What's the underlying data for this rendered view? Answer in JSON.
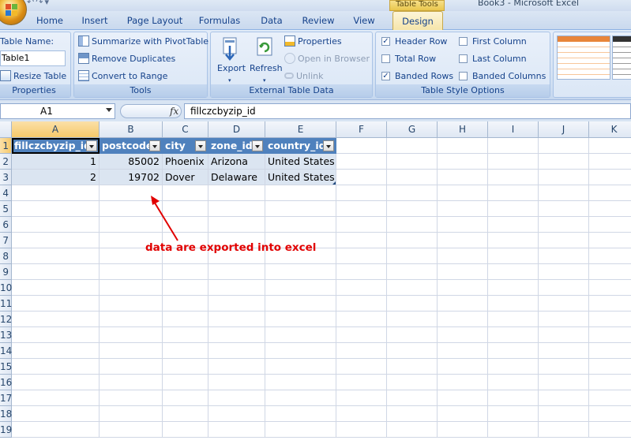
{
  "window": {
    "title": "Book3 - Microsoft Excel",
    "context_tab": "Table Tools"
  },
  "tabs": [
    "Home",
    "Insert",
    "Page Layout",
    "Formulas",
    "Data",
    "Review",
    "View",
    "Design"
  ],
  "active_tab": "Design",
  "ribbon": {
    "properties": {
      "table_name_label": "Table Name:",
      "table_name_value": "Table1",
      "resize": "Resize Table",
      "group": "Properties"
    },
    "tools": {
      "summarize": "Summarize with PivotTable",
      "remove_duplicates": "Remove Duplicates",
      "convert": "Convert to Range",
      "group": "Tools"
    },
    "external": {
      "export": "Export",
      "refresh": "Refresh",
      "properties": "Properties",
      "open_browser": "Open in Browser",
      "unlink": "Unlink",
      "group": "External Table Data"
    },
    "style_options": {
      "header_row": "Header Row",
      "total_row": "Total Row",
      "banded_rows": "Banded Rows",
      "first_column": "First Column",
      "last_column": "Last Column",
      "banded_columns": "Banded Columns",
      "group": "Table Style Options",
      "header_row_checked": true,
      "total_row_checked": false,
      "banded_rows_checked": true,
      "first_column_checked": false,
      "last_column_checked": false,
      "banded_columns_checked": false
    }
  },
  "formula_bar": {
    "name_box": "A1",
    "fx": "fx",
    "value": "fillczcbyzip_id"
  },
  "columns": [
    "A",
    "B",
    "C",
    "D",
    "E",
    "F",
    "G",
    "H",
    "I",
    "J",
    "K"
  ],
  "row_numbers": [
    "1",
    "2",
    "3",
    "4",
    "5",
    "6",
    "7",
    "8",
    "9",
    "10",
    "11",
    "12",
    "13",
    "14",
    "15",
    "16",
    "17",
    "18",
    "19"
  ],
  "table": {
    "headers": [
      "fillczcbyzip_id",
      "postcode",
      "city",
      "zone_id",
      "country_id"
    ],
    "rows": [
      [
        "1",
        "85002",
        "Phoenix",
        "Arizona",
        "United States"
      ],
      [
        "2",
        "19702",
        "Dover",
        "Delaware",
        "United States"
      ]
    ]
  },
  "annotation": "data are exported into excel",
  "colors": {
    "table_header": "#4f81bd",
    "band": "#dbe5f1",
    "annotation": "#e10000",
    "selected_header": "#f6c96a"
  }
}
